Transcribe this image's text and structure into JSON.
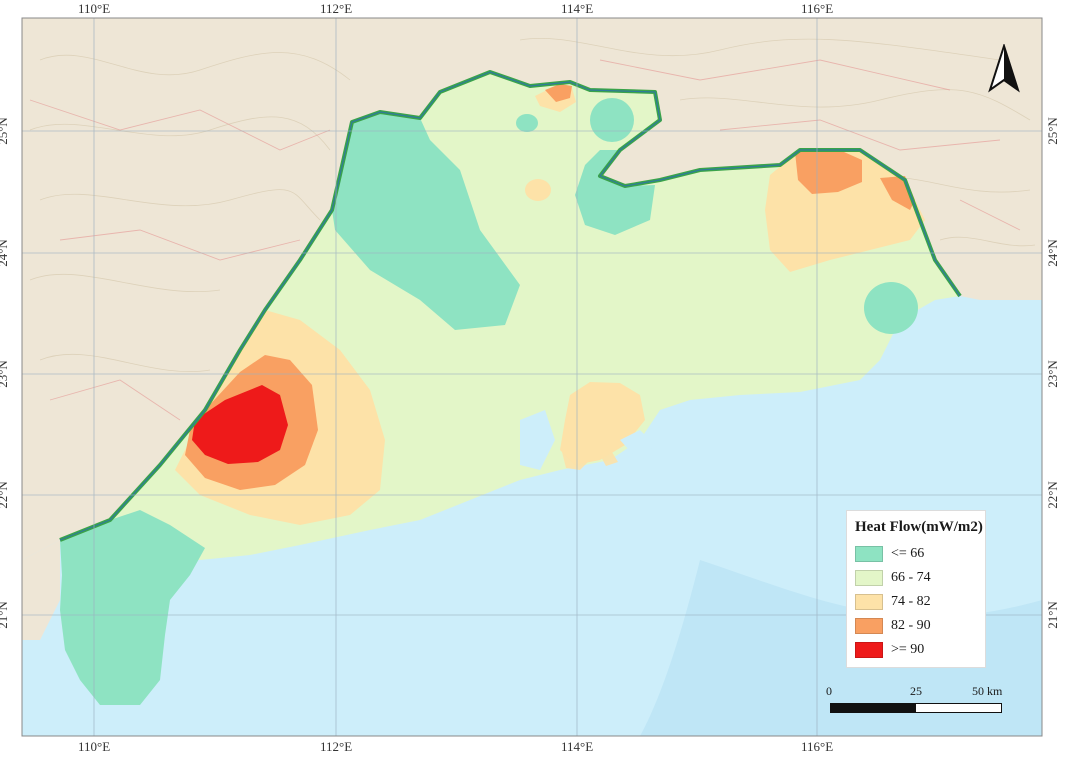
{
  "map": {
    "top_lon_labels": [
      "110°E",
      "112°E",
      "114°E",
      "116°E"
    ],
    "bottom_lon_labels": [
      "110°E",
      "112°E",
      "114°E",
      "116°E"
    ],
    "left_lat_labels": [
      "25°N",
      "24°N",
      "23°N",
      "22°N",
      "21°N"
    ],
    "right_lat_labels": [
      "25°N",
      "24°N",
      "23°N",
      "22°N",
      "21°N"
    ]
  },
  "legend": {
    "title": "Heat Flow(mW/m2)",
    "items": [
      {
        "label": "<= 66",
        "color": "#8ee3c2"
      },
      {
        "label": "66 - 74",
        "color": "#e3f6c8"
      },
      {
        "label": "74 - 82",
        "color": "#fde2a8"
      },
      {
        "label": "82 - 90",
        "color": "#f9a062"
      },
      {
        "label": ">= 90",
        "color": "#ee1a1a"
      }
    ]
  },
  "scalebar": {
    "ticks": [
      "0",
      "25",
      "50 km"
    ]
  },
  "colors": {
    "sea": "#cdeefa",
    "land": "#efe9dc",
    "border": "#3aa34a",
    "grid": "#9cb0c0"
  },
  "north_arrow": {
    "icon": "north-arrow-icon"
  }
}
